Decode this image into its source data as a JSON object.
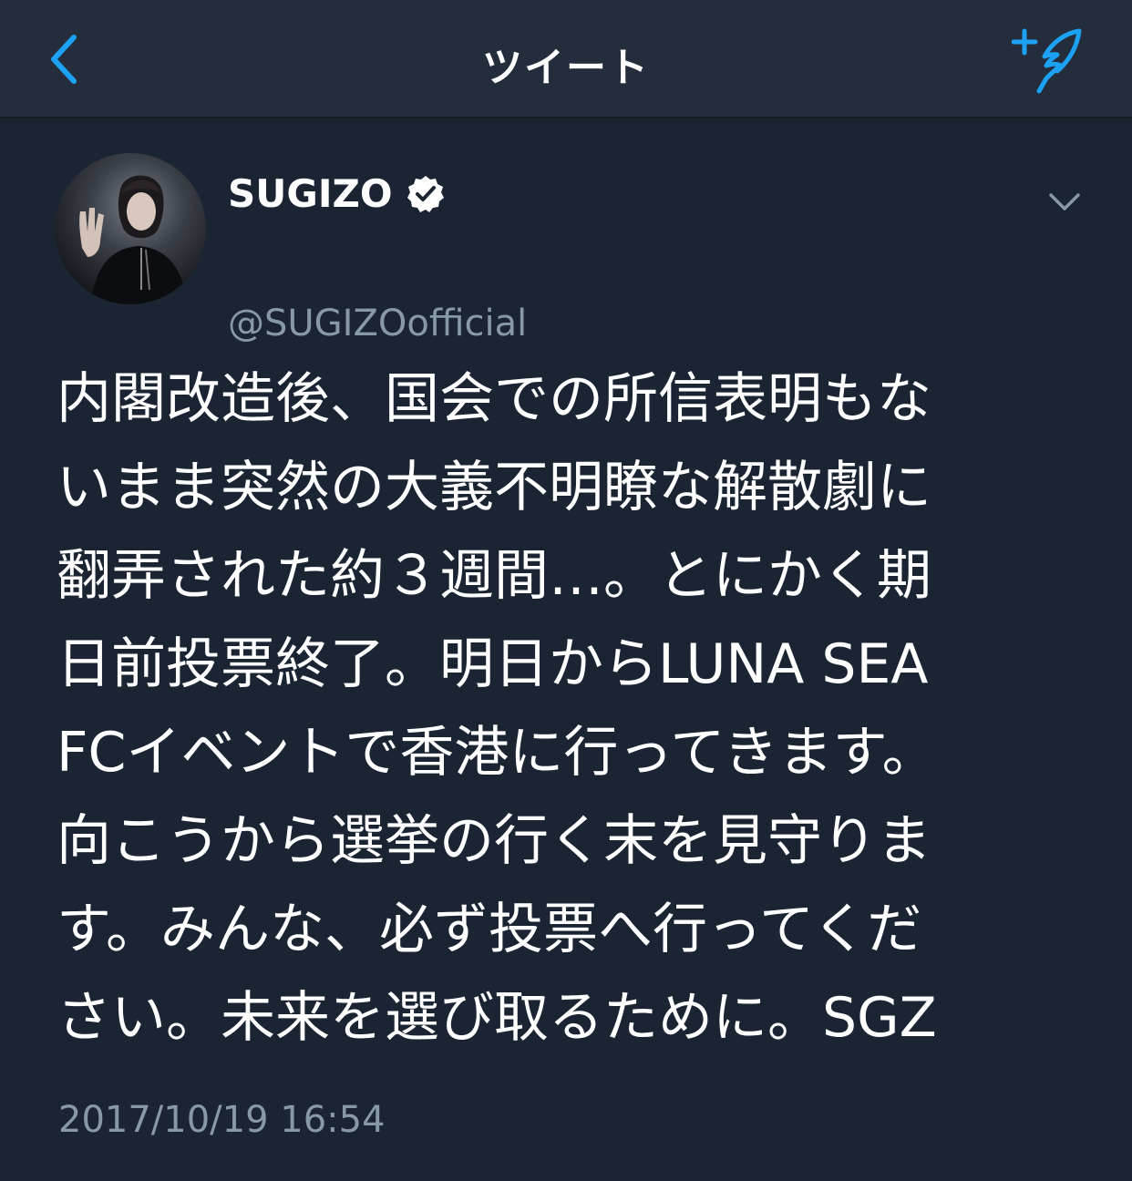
{
  "colors": {
    "background": "#1b2432",
    "navbar": "#232d3b",
    "accent": "#1da1f2",
    "secondary_text": "#8899a6",
    "primary_text": "#ffffff"
  },
  "navbar": {
    "back_icon": "chevron-left-icon",
    "title": "ツイート",
    "compose_icon": "compose-tweet-icon"
  },
  "tweet": {
    "author": {
      "display_name": "SUGIZO",
      "verified": true,
      "verified_icon": "verified-badge-icon",
      "handle": "@SUGIZOofficial"
    },
    "menu_icon": "chevron-down-icon",
    "text_lines": [
      "内閣改造後、国会での所信表明もな",
      "いまま突然の大義不明瞭な解散劇に",
      "翻弄された約３週間…。とにかく期",
      "日前投票終了。明日からLUNA SEA",
      "FCイベントで香港に行ってきます。",
      "向こうから選挙の行く末を見守りま",
      "す。みんな、必ず投票へ行ってくだ",
      "さい。未来を選び取るために。SGZ"
    ],
    "timestamp": "2017/10/19 16:54"
  }
}
